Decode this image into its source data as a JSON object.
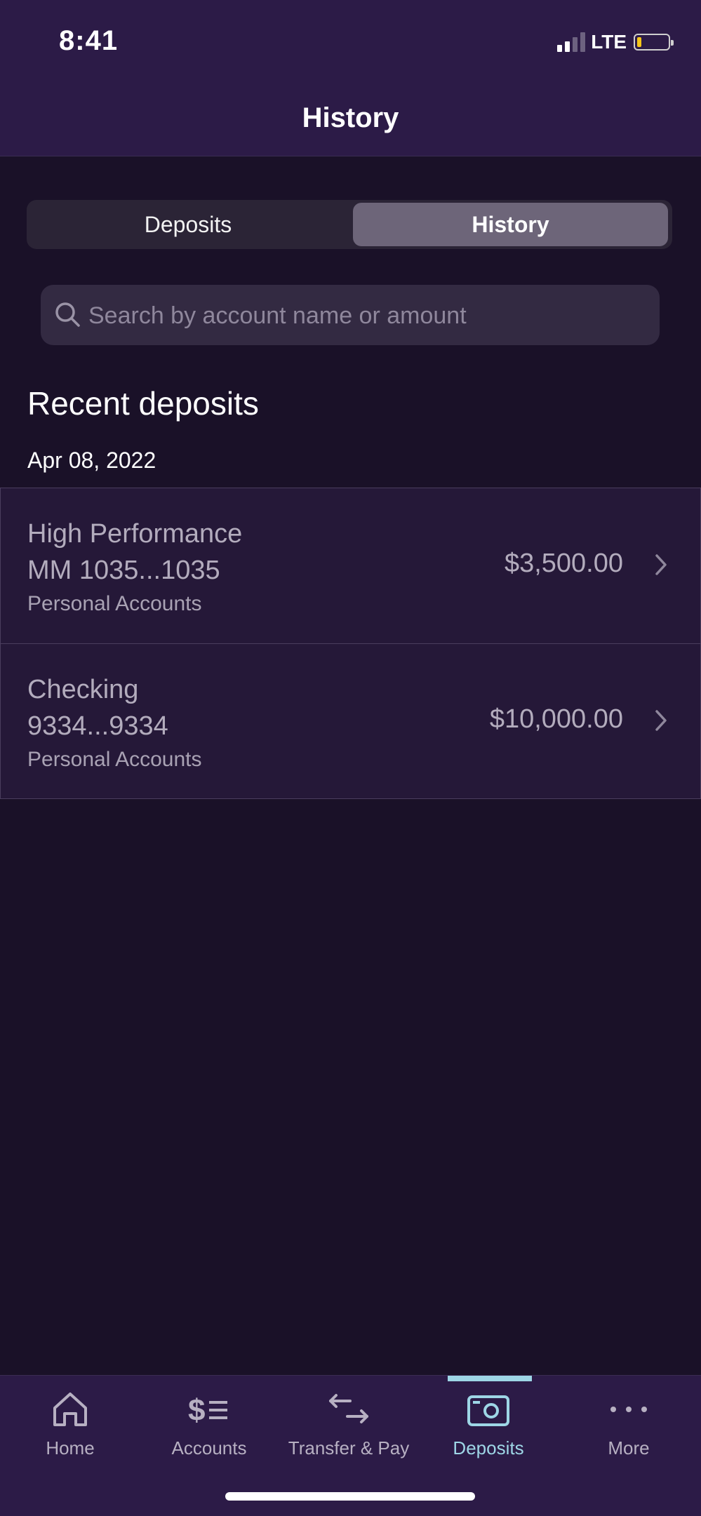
{
  "status_bar": {
    "time": "8:41",
    "network": "LTE"
  },
  "header": {
    "title": "History"
  },
  "segmented_control": {
    "options": [
      "Deposits",
      "History"
    ],
    "selected": "History"
  },
  "search": {
    "placeholder": "Search by account name or amount",
    "value": ""
  },
  "section_title": "Recent deposits",
  "date_group": "Apr 08, 2022",
  "deposits": [
    {
      "name": "High Performance",
      "number": "MM 1035...1035",
      "category": "Personal Accounts",
      "amount": "$3,500.00"
    },
    {
      "name": "Checking",
      "number": "9334...9334",
      "category": "Personal Accounts",
      "amount": "$10,000.00"
    }
  ],
  "tab_bar": {
    "tabs": [
      {
        "label": "Home",
        "icon": "home-icon"
      },
      {
        "label": "Accounts",
        "icon": "accounts-icon"
      },
      {
        "label": "Transfer & Pay",
        "icon": "transfer-icon"
      },
      {
        "label": "Deposits",
        "icon": "deposit-camera-icon"
      },
      {
        "label": "More",
        "icon": "more-icon"
      }
    ],
    "active": "Deposits"
  },
  "colors": {
    "accent": "#9ed6e6",
    "header_bg": "#2c1b47",
    "page_bg": "#1a1128",
    "row_bg": "#251838"
  }
}
